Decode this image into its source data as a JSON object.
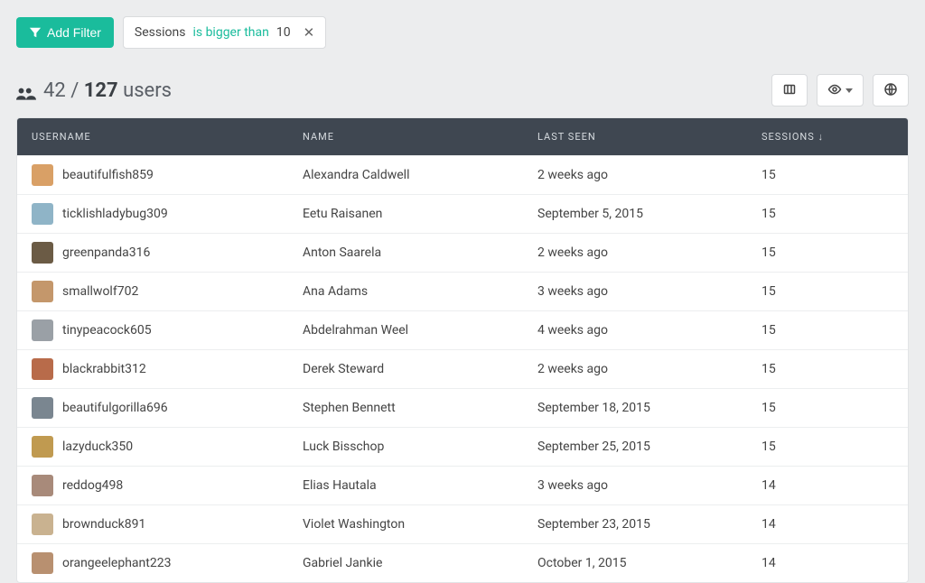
{
  "toolbar": {
    "add_filter_label": "Add Filter",
    "chip": {
      "field": "Sessions",
      "operator": "is bigger than",
      "value": "10"
    }
  },
  "summary": {
    "filtered": "42",
    "separator": " / ",
    "total": "127",
    "noun": "users"
  },
  "columns": {
    "username": "USERNAME",
    "name": "NAME",
    "last_seen": "LAST SEEN",
    "sessions": "SESSIONS ↓"
  },
  "rows": [
    {
      "username": "beautifulfish859",
      "name": "Alexandra Caldwell",
      "last_seen": "2 weeks ago",
      "sessions": "15"
    },
    {
      "username": "ticklishladybug309",
      "name": "Eetu Raisanen",
      "last_seen": "September 5, 2015",
      "sessions": "15"
    },
    {
      "username": "greenpanda316",
      "name": "Anton Saarela",
      "last_seen": "2 weeks ago",
      "sessions": "15"
    },
    {
      "username": "smallwolf702",
      "name": "Ana Adams",
      "last_seen": "3 weeks ago",
      "sessions": "15"
    },
    {
      "username": "tinypeacock605",
      "name": "Abdelrahman Weel",
      "last_seen": "4 weeks ago",
      "sessions": "15"
    },
    {
      "username": "blackrabbit312",
      "name": "Derek Steward",
      "last_seen": "2 weeks ago",
      "sessions": "15"
    },
    {
      "username": "beautifulgorilla696",
      "name": "Stephen Bennett",
      "last_seen": "September 18, 2015",
      "sessions": "15"
    },
    {
      "username": "lazyduck350",
      "name": "Luck Bisschop",
      "last_seen": "September 25, 2015",
      "sessions": "15"
    },
    {
      "username": "reddog498",
      "name": "Elias Hautala",
      "last_seen": "3 weeks ago",
      "sessions": "14"
    },
    {
      "username": "brownduck891",
      "name": "Violet Washington",
      "last_seen": "September 23, 2015",
      "sessions": "14"
    },
    {
      "username": "orangeelephant223",
      "name": "Gabriel Jankie",
      "last_seen": "October 1, 2015",
      "sessions": "14"
    }
  ]
}
